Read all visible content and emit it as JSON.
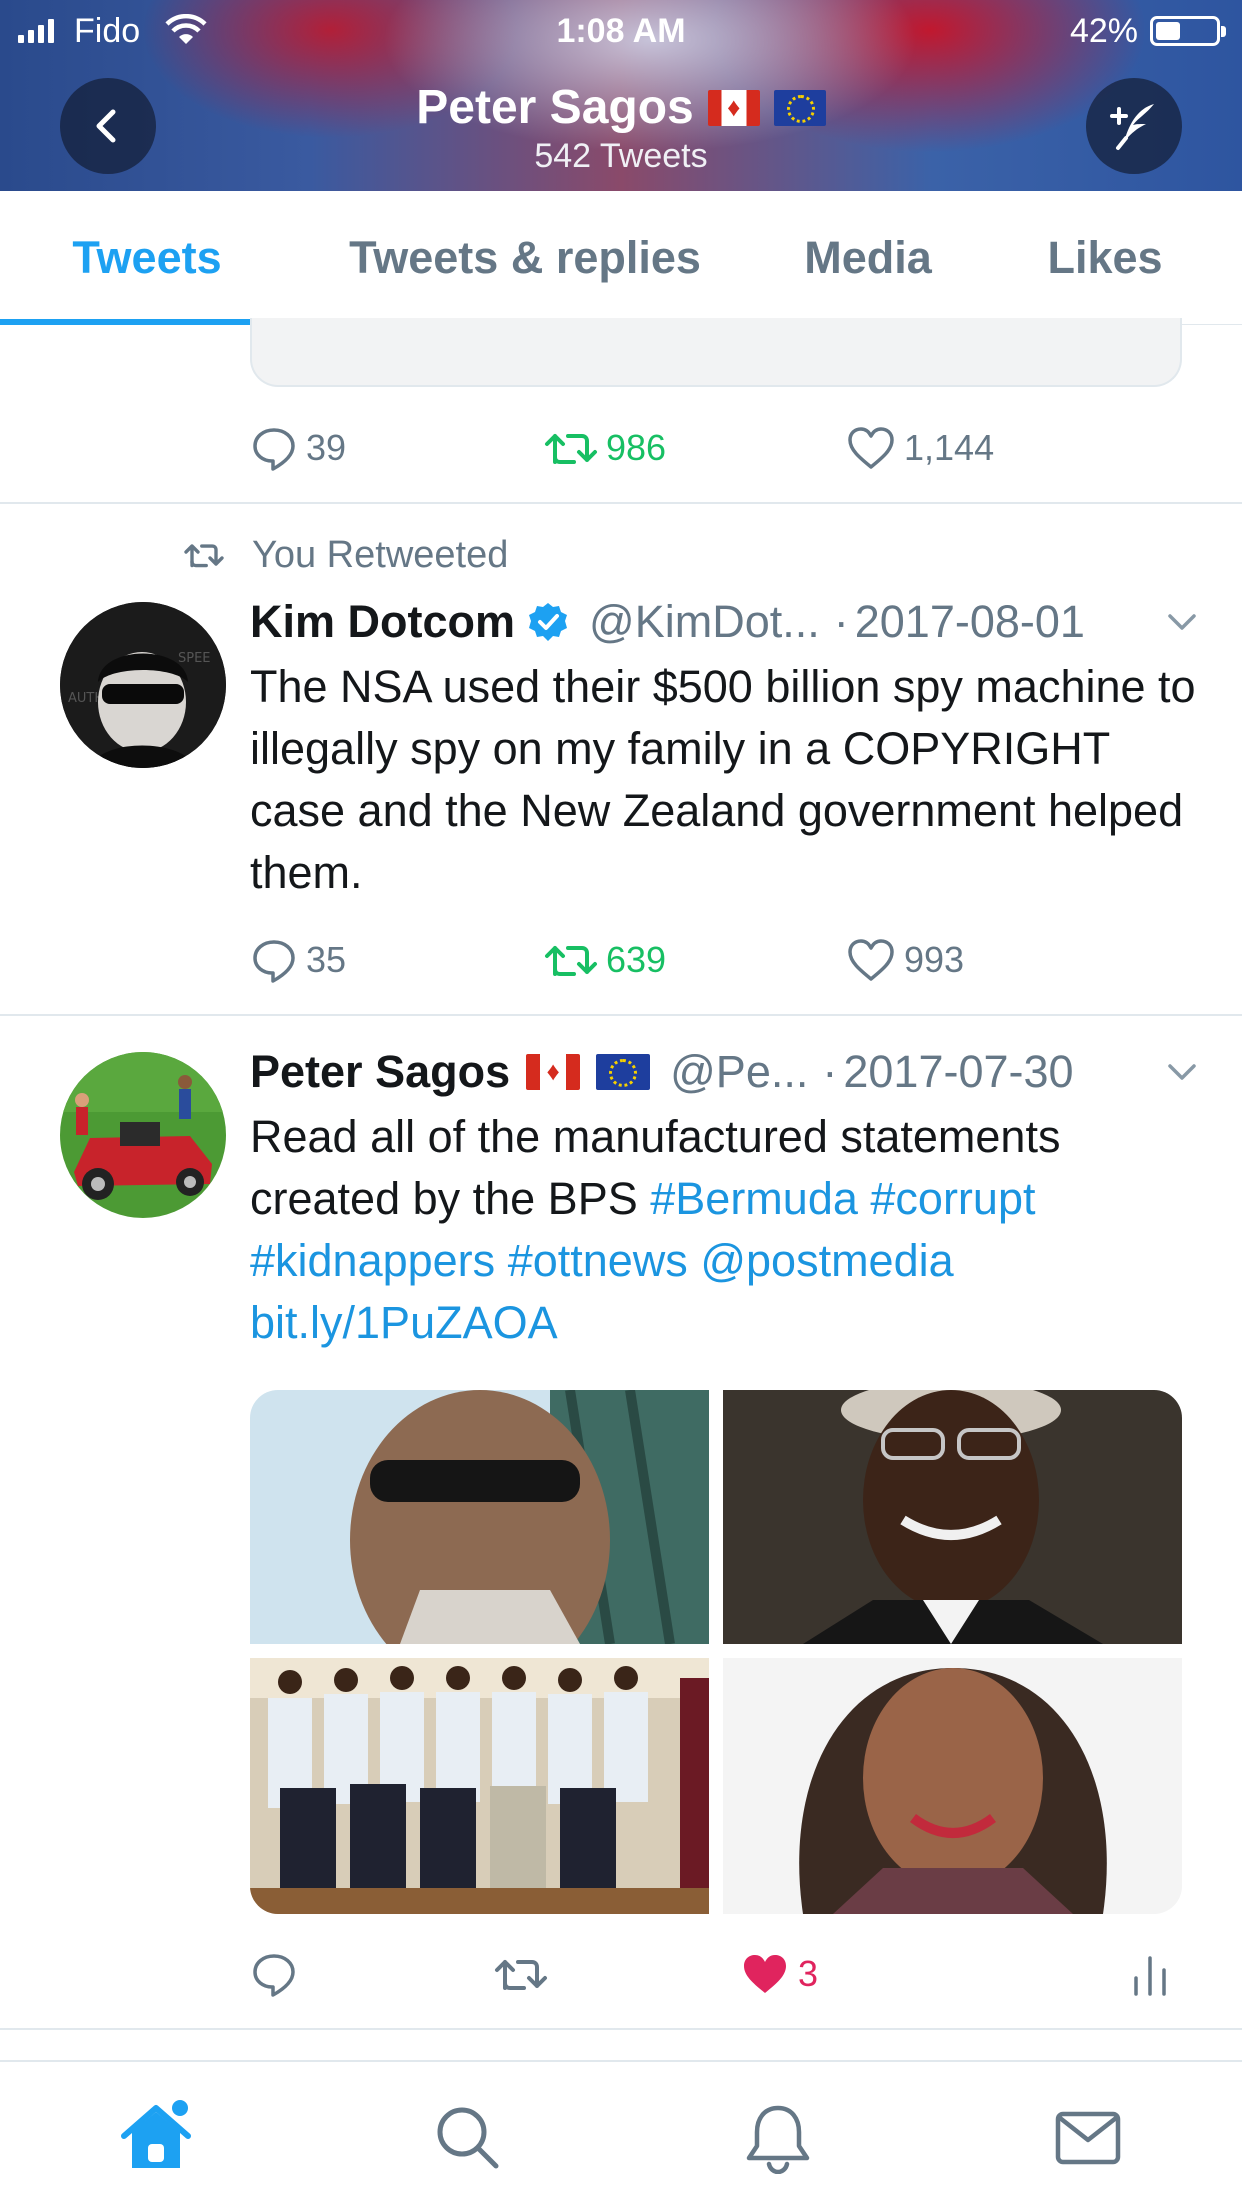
{
  "status_bar": {
    "carrier": "Fido",
    "time": "1:08 AM",
    "battery_percent": "42%",
    "battery_level": 0.42
  },
  "header": {
    "profile_name": "Peter Sagos",
    "tweet_count": "542 Tweets",
    "flags": [
      "canada-flag",
      "eu-flag"
    ]
  },
  "tabs": [
    {
      "label": "Tweets",
      "active": true
    },
    {
      "label": "Tweets & replies",
      "active": false
    },
    {
      "label": "Media",
      "active": false
    },
    {
      "label": "Likes",
      "active": false
    }
  ],
  "tweets": [
    {
      "replies": "39",
      "retweets": "986",
      "likes": "1,144"
    },
    {
      "retweeted_label": "You Retweeted",
      "name": "Kim Dotcom",
      "verified": true,
      "handle": "@KimDot...",
      "separator": "·",
      "date": "2017-08-01",
      "text": "The NSA used their $500 billion spy machine to illegally spy on my family in a COPYRIGHT case and the New Zealand government helped them.",
      "replies": "35",
      "retweets": "639",
      "likes": "993"
    },
    {
      "name": "Peter Sagos",
      "handle": "@Pe...",
      "separator": "·",
      "date": "2017-07-30",
      "text_plain": "Read all of the manufactured statements created by the BPS",
      "hashtags": [
        "#Bermuda",
        "#corrupt",
        "#kidnappers",
        "#ottnews"
      ],
      "mention": "@postmedia",
      "url": "bit.ly/1PuZAOA",
      "likes": "3",
      "liked": true
    }
  ],
  "bottom_nav": [
    "home-icon",
    "search-icon",
    "notifications-icon",
    "messages-icon"
  ],
  "colors": {
    "accent": "#1da1f2",
    "link": "#1b95e0",
    "retweet": "#17bf63",
    "like": "#e0245e",
    "muted": "#657786"
  }
}
